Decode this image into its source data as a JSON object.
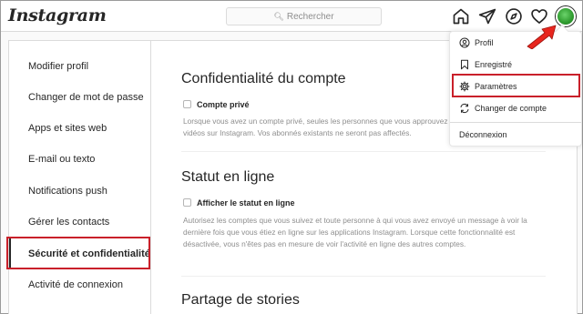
{
  "header": {
    "logo": "Instagram",
    "search_placeholder": "Rechercher"
  },
  "nav_icons": [
    "home-icon",
    "direct-icon",
    "explore-icon",
    "activity-heart-icon",
    "profile-avatar"
  ],
  "sidebar": {
    "items": [
      {
        "label": "Modifier profil"
      },
      {
        "label": "Changer de mot de passe"
      },
      {
        "label": "Apps et sites web"
      },
      {
        "label": "E-mail ou texto"
      },
      {
        "label": "Notifications push"
      },
      {
        "label": "Gérer les contacts"
      },
      {
        "label": "Sécurité et confidentialité",
        "active": true
      },
      {
        "label": "Activité de connexion"
      }
    ]
  },
  "main": {
    "privacy": {
      "title": "Confidentialité du compte",
      "checkbox_label": "Compte privé",
      "description": "Lorsque vous avez un compte privé, seules les personnes que vous approuvez peuvent voir vos photos et vidéos sur Instagram. Vos abonnés existants ne seront pas affectés."
    },
    "online": {
      "title": "Statut en ligne",
      "checkbox_label": "Afficher le statut en ligne",
      "description": "Autorisez les comptes que vous suivez et toute personne à qui vous avez envoyé un message à voir la dernière fois que vous étiez en ligne sur les applications Instagram. Lorsque cette fonctionnalité est désactivée, vous n'êtes pas en mesure de voir l'activité en ligne des autres comptes."
    },
    "stories": {
      "title": "Partage de stories"
    }
  },
  "menu": {
    "items": [
      {
        "label": "Profil",
        "icon": "profile-icon"
      },
      {
        "label": "Enregistré",
        "icon": "bookmark-icon"
      },
      {
        "label": "Paramètres",
        "icon": "settings-gear-icon"
      },
      {
        "label": "Changer de compte",
        "icon": "switch-account-icon"
      }
    ],
    "logout": "Déconnexion"
  },
  "colors": {
    "highlight": "#c9202a",
    "arrow": "#e8261e",
    "border": "#dbdbdb",
    "muted_text": "#8e8e8e"
  }
}
